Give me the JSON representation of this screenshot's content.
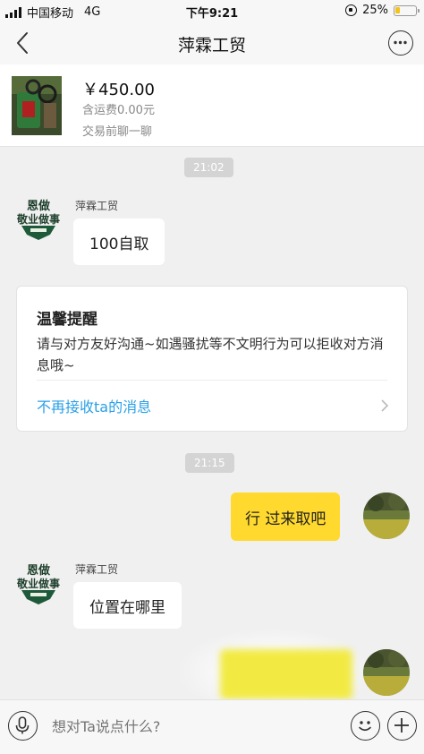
{
  "status_bar": {
    "carrier": "中国移动",
    "network": "4G",
    "time": "下午9:21",
    "battery_text": "25%",
    "battery_level": 0.25,
    "battery_color": "#f4c21c"
  },
  "nav": {
    "title": "萍霖工贸",
    "back_icon": "chevron-left-icon",
    "more_icon": "more-horizontal-icon"
  },
  "product": {
    "price": "￥450.00",
    "shipping": "含运费0.00元",
    "hint": "交易前聊一聊"
  },
  "chat": {
    "time_1": "21:02",
    "msg_1": {
      "sender": "萍霖工贸",
      "text": "100自取"
    },
    "notice": {
      "title": "温馨提醒",
      "body": "请与对方友好沟通~如遇骚扰等不文明行为可以拒收对方消息哦~",
      "link": "不再接收ta的消息"
    },
    "time_2": "21:15",
    "msg_2": {
      "text": "行 过来取吧"
    },
    "msg_3": {
      "sender": "萍霖工贸",
      "text": "位置在哪里"
    },
    "seller_logo_text": [
      "恩做",
      "敬业做事"
    ]
  },
  "input": {
    "placeholder": "想对Ta说点什么?",
    "mic_icon": "microphone-icon",
    "emoji_icon": "smile-icon",
    "plus_icon": "plus-icon"
  },
  "colors": {
    "outgoing_bubble": "#ffd92e",
    "link": "#2aa0e6",
    "time_chip": "#d4d4d4"
  }
}
